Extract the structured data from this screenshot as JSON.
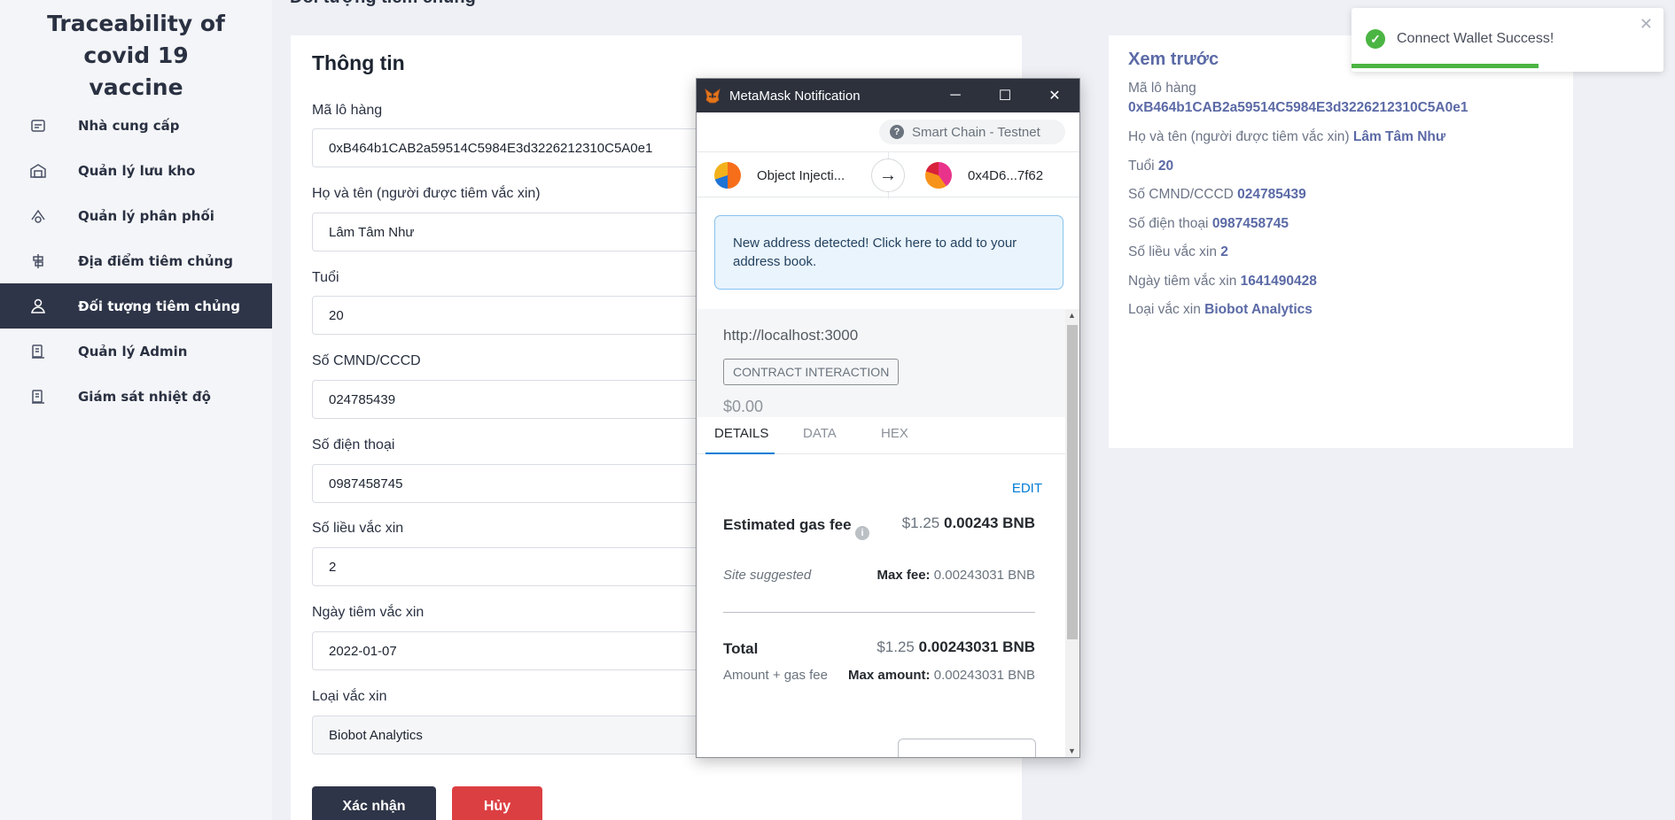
{
  "app": {
    "brand": "Traceability of covid 19 vaccine"
  },
  "sidebar": {
    "items": [
      {
        "label": "Nhà cung cấp",
        "icon": "supplier-icon",
        "active": false
      },
      {
        "label": "Quản lý lưu kho",
        "icon": "warehouse-icon",
        "active": false
      },
      {
        "label": "Quản lý phân phối",
        "icon": "distribution-icon",
        "active": false
      },
      {
        "label": "Địa điểm tiêm chủng",
        "icon": "location-icon",
        "active": false
      },
      {
        "label": "Đối tượng tiêm chủng",
        "icon": "person-icon",
        "active": true
      },
      {
        "label": "Quản lý Admin",
        "icon": "admin-icon",
        "active": false
      },
      {
        "label": "Giám sát nhiệt độ",
        "icon": "thermometer-icon",
        "active": false
      }
    ]
  },
  "page": {
    "heading": "Đối tượng tiêm chủng"
  },
  "form": {
    "title": "Thông tin",
    "fields": [
      {
        "label": "Mã lô hàng",
        "value": "0xB464b1CAB2a59514C5984E3d3226212310C5A0e1"
      },
      {
        "label": "Họ và tên (người được tiêm vắc xin)",
        "value": "Lâm Tâm Như"
      },
      {
        "label": "Tuổi",
        "value": "20"
      },
      {
        "label": "Số CMND/CCCD",
        "value": "024785439"
      },
      {
        "label": "Số điện thoại",
        "value": "0987458745"
      },
      {
        "label": "Số liều vắc xin",
        "value": "2"
      },
      {
        "label": "Ngày tiêm vắc xin",
        "value": "2022-01-07"
      },
      {
        "label": "Loại vắc xin",
        "value": "Biobot Analytics"
      }
    ],
    "confirm_label": "Xác nhận",
    "cancel_label": "Hủy"
  },
  "preview": {
    "title": "Xem trước",
    "batch_label": "Mã lô hàng",
    "batch_value": "0xB464b1CAB2a59514C5984E3d3226212310C5A0e1",
    "rows": [
      {
        "label": "Họ và tên (người được tiêm vắc xin)",
        "value": "Lâm Tâm Như"
      },
      {
        "label": "Tuổi",
        "value": "20"
      },
      {
        "label": "Số CMND/CCCD",
        "value": "024785439"
      },
      {
        "label": "Số điện thoại",
        "value": "0987458745"
      },
      {
        "label": "Số liều vắc xin",
        "value": "2"
      },
      {
        "label": "Ngày tiêm vắc xin",
        "value": "1641490428"
      },
      {
        "label": "Loại vắc xin",
        "value": "Biobot Analytics"
      }
    ]
  },
  "toast": {
    "message": "Connect Wallet Success!",
    "progress": 0.6,
    "color": "#4bb543"
  },
  "metamask": {
    "window_title": "MetaMask Notification",
    "network": "Smart Chain - Testnet",
    "from_account": "Object Injecti...",
    "to_account": "0x4D6...7f62",
    "alert": "New address detected! Click here to add to your address book.",
    "origin": "http://localhost:3000",
    "badge": "CONTRACT INTERACTION",
    "amount": "$0.00",
    "tabs": [
      "DETAILS",
      "DATA",
      "HEX"
    ],
    "edit_label": "EDIT",
    "gas_label": "Estimated gas fee",
    "gas_fiat": "$1.25",
    "gas_crypto": "0.00243 BNB",
    "site_suggested": "Site suggested",
    "max_fee_label": "Max fee:",
    "max_fee_value": "0.00243031 BNB",
    "total_label": "Total",
    "total_fiat": "$1.25",
    "total_crypto": "0.00243031 BNB",
    "amount_gas_label": "Amount + gas fee",
    "max_amount_label": "Max amount:",
    "max_amount_value": "0.00243031 BNB"
  },
  "colors": {
    "sidebar_active": "#2e3548",
    "accent": "#5b6aa6",
    "cancel": "#dc3f42",
    "metamask_blue": "#037dd6"
  }
}
